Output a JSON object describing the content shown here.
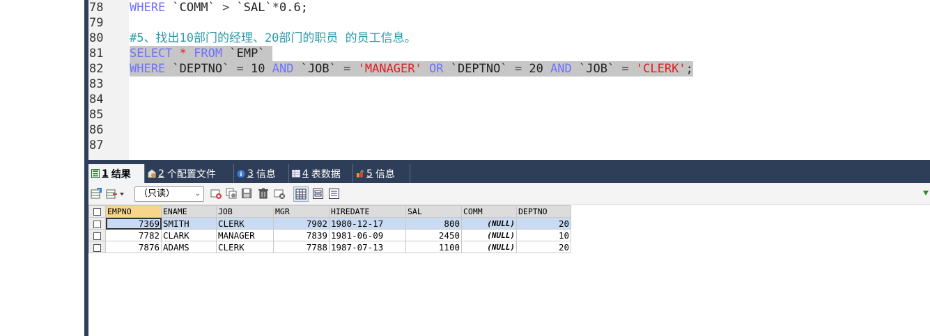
{
  "editor": {
    "lines": [
      {
        "no": "78",
        "tokens": [
          {
            "t": "kw",
            "v": "WHERE"
          },
          {
            "t": "tx",
            "v": " `COMM` "
          },
          {
            "t": "op",
            "v": ">"
          },
          {
            "t": "tx",
            "v": " `SAL`"
          },
          {
            "t": "op",
            "v": "*"
          },
          {
            "t": "tx",
            "v": "0.6;"
          }
        ]
      },
      {
        "no": "79",
        "tokens": []
      },
      {
        "no": "80",
        "tokens": [
          {
            "t": "cm",
            "v": "#5、找出10部门的经理、20部门的职员 的员工信息。"
          }
        ]
      },
      {
        "no": "81",
        "selected": true,
        "tokens": [
          {
            "t": "kw",
            "v": "SELECT"
          },
          {
            "t": "tx",
            "v": " "
          },
          {
            "t": "str",
            "v": "*"
          },
          {
            "t": "tx",
            "v": " "
          },
          {
            "t": "kw",
            "v": "FROM"
          },
          {
            "t": "tx",
            "v": " `EMP` "
          }
        ]
      },
      {
        "no": "82",
        "selected": true,
        "tokens": [
          {
            "t": "kw",
            "v": "WHERE"
          },
          {
            "t": "tx",
            "v": " `DEPTNO` "
          },
          {
            "t": "op",
            "v": "="
          },
          {
            "t": "tx",
            "v": " 10 "
          },
          {
            "t": "kw",
            "v": "AND"
          },
          {
            "t": "tx",
            "v": " `JOB` "
          },
          {
            "t": "op",
            "v": "="
          },
          {
            "t": "tx",
            "v": " "
          },
          {
            "t": "str",
            "v": "'MANAGER'"
          },
          {
            "t": "tx",
            "v": " "
          },
          {
            "t": "kw",
            "v": "OR"
          },
          {
            "t": "tx",
            "v": " `DEPTNO` "
          },
          {
            "t": "op",
            "v": "="
          },
          {
            "t": "tx",
            "v": " 20 "
          },
          {
            "t": "kw",
            "v": "AND"
          },
          {
            "t": "tx",
            "v": " `JOB` "
          },
          {
            "t": "op",
            "v": "="
          },
          {
            "t": "tx",
            "v": " "
          },
          {
            "t": "str",
            "v": "'CLERK'"
          },
          {
            "t": "tx",
            "v": ";"
          }
        ]
      },
      {
        "no": "83",
        "tokens": []
      },
      {
        "no": "84",
        "tokens": []
      },
      {
        "no": "85",
        "tokens": []
      },
      {
        "no": "86",
        "tokens": []
      },
      {
        "no": "87",
        "tokens": []
      }
    ]
  },
  "tabs": [
    {
      "num": "1",
      "label": "结果",
      "icon": "result-grid-icon",
      "active": true
    },
    {
      "num": "2",
      "label": "个配置文件",
      "icon": "profile-icon"
    },
    {
      "num": "3",
      "label": "信息",
      "icon": "info-icon"
    },
    {
      "num": "4",
      "label": "表数据",
      "icon": "table-data-icon"
    },
    {
      "num": "5",
      "label": "信息",
      "icon": "info2-icon"
    }
  ],
  "toolbar": {
    "mode": "（只读）"
  },
  "results": {
    "columns": [
      "EMPNO",
      "ENAME",
      "JOB",
      "MGR",
      "HIREDATE",
      "SAL",
      "COMM",
      "DEPTNO"
    ],
    "rows": [
      [
        "7369",
        "SMITH",
        "CLERK",
        "7902",
        "1980-12-17",
        "800",
        "(NULL)",
        "20"
      ],
      [
        "7782",
        "CLARK",
        "MANAGER",
        "7839",
        "1981-06-09",
        "2450",
        "(NULL)",
        "10"
      ],
      [
        "7876",
        "ADAMS",
        "CLERK",
        "7788",
        "1987-07-13",
        "1100",
        "(NULL)",
        "20"
      ]
    ]
  },
  "colors": {
    "keyword": "#7070ff",
    "string": "#e02020",
    "comment": "#2d9aa8",
    "selection": "#c6c6c6",
    "tabbar": "#2f3e58",
    "row_selected": "#c9dbf3"
  }
}
